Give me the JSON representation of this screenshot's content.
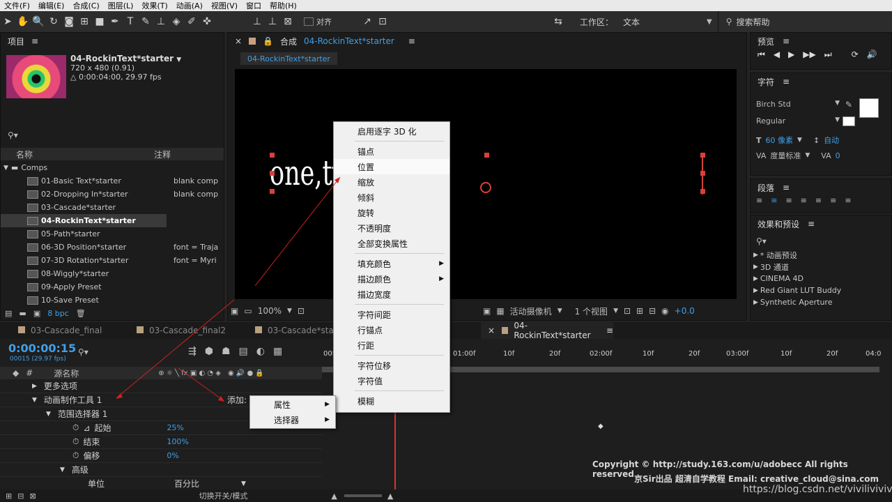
{
  "menu": [
    "文件(F)",
    "编辑(E)",
    "合成(C)",
    "图层(L)",
    "效果(T)",
    "动画(A)",
    "视图(V)",
    "窗口",
    "帮助(H)"
  ],
  "toolbar": {
    "align_label": "对齐",
    "workspace_label": "工作区：",
    "workspace_value": "文本",
    "search_help": "搜索帮助"
  },
  "project": {
    "title": "项目",
    "comp_name": "04-RockinText*starter",
    "comp_size": "720 x 480 (0.91)",
    "comp_dur": "△ 0:00:04:00, 29.97 fps",
    "col_name": "名称",
    "col_comment": "注释",
    "folder": "Comps",
    "items": [
      {
        "name": "01-Basic Text*starter",
        "comment": "blank comp"
      },
      {
        "name": "02-Dropping In*starter",
        "comment": "blank comp"
      },
      {
        "name": "03-Cascade*starter",
        "comment": ""
      },
      {
        "name": "04-RockinText*starter",
        "comment": ""
      },
      {
        "name": "05-Path*starter",
        "comment": ""
      },
      {
        "name": "06-3D Position*starter",
        "comment": "font = Traja"
      },
      {
        "name": "07-3D Rotation*starter",
        "comment": "font = Myri"
      },
      {
        "name": "08-Wiggly*starter",
        "comment": ""
      },
      {
        "name": "09-Apply Preset",
        "comment": ""
      },
      {
        "name": "10-Save Preset",
        "comment": ""
      }
    ],
    "bpc": "8 bpc"
  },
  "comp": {
    "title": "合成",
    "name": "04-RockinText*starter",
    "tab": "04-RockinText*starter",
    "text": "one,tv",
    "zoom": "100%",
    "camera": "活动摄像机",
    "views": "1 个视图",
    "exposure": "+0.0"
  },
  "preview": {
    "title": "预览"
  },
  "character": {
    "title": "字符",
    "font": "Birch Std",
    "style": "Regular",
    "size": "60 像素",
    "leading": "自动",
    "tracking_label": "度量标准",
    "tracking": "0"
  },
  "paragraph": {
    "title": "段落"
  },
  "effects": {
    "title": "效果和预设",
    "items": [
      "* 动画预设",
      "3D 通道",
      "CINEMA 4D",
      "Red Giant LUT Buddy",
      "Synthetic Aperture"
    ]
  },
  "context_menu": [
    "启用逐字 3D 化",
    "锚点",
    "位置",
    "缩放",
    "倾斜",
    "旋转",
    "不透明度",
    "全部变换属性",
    "填充颜色",
    "描边颜色",
    "描边宽度",
    "字符间距",
    "行锚点",
    "行距",
    "字符位移",
    "字符值",
    "模糊"
  ],
  "sub_menu": [
    "属性",
    "选择器"
  ],
  "timeline": {
    "tabs": [
      "03-Cascade_final",
      "03-Cascade_final2",
      "03-Cascade*starter",
      "04-RockinText*starter"
    ],
    "timecode": "0:00:00:15",
    "fps": "00015 (29.97 fps)",
    "col_source": "源名称",
    "rows": [
      "更多选项",
      "动画制作工具 1",
      "范围选择器 1",
      "起始",
      "结束",
      "偏移",
      "高级",
      "单位"
    ],
    "add_label": "添加:",
    "values": {
      "start": "25%",
      "end": "100%",
      "offset": "0%",
      "unit": "百分比"
    },
    "ruler": [
      "00f",
      "01:00f",
      "10f",
      "20f",
      "02:00f",
      "10f",
      "20f",
      "03:00f",
      "10f",
      "20f",
      "04:0"
    ],
    "bottom_label": "切换开关/模式"
  },
  "watermark": {
    "copyright": "Copyright © http://study.163.com/u/adobecc All rights reserved",
    "credit": "京Sir出品 超清自学教程 Email: creative_cloud@sina.com",
    "url": "https://blog.csdn.net/vivilivivivng"
  }
}
